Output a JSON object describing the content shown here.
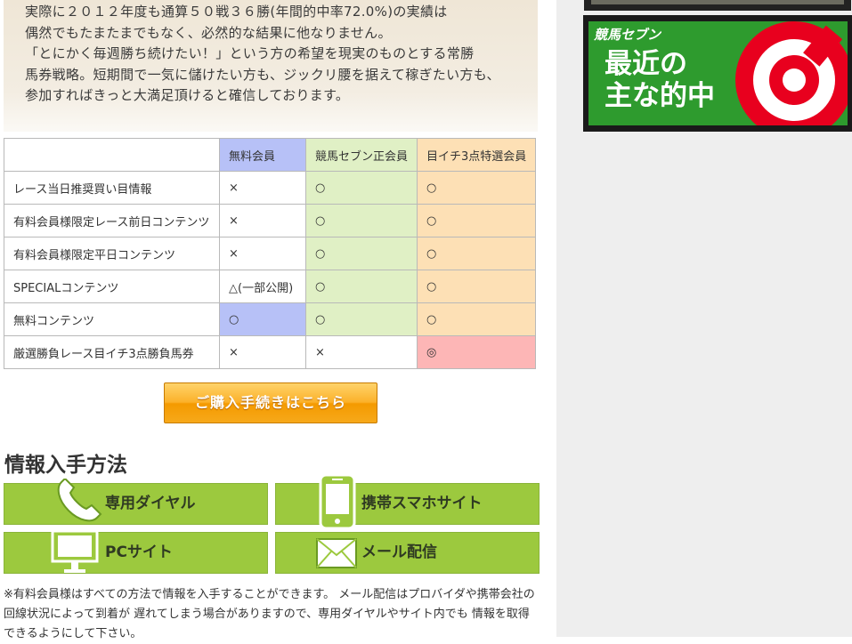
{
  "intro": {
    "lines": [
      "実際に２０１２年度も通算５０戦３６勝(年間的中率72.0%)の実績は",
      "偶然でもたまたまでもなく、必然的な結果に他なりません。",
      "「とにかく毎週勝ち続けたい！」という方の希望を現実のものとする常勝",
      "馬券戦略。短期間で一気に儲けたい方も、ジックリ腰を据えて稼ぎたい方も、",
      "参加すればきっと大満足頂けると確信しております。"
    ]
  },
  "table": {
    "headers": [
      "",
      "無料会員",
      "競馬セブン正会員",
      "目イチ3点特選会員"
    ],
    "rows": [
      [
        "レース当日推奨買い目情報",
        "×",
        "○",
        "○"
      ],
      [
        "有料会員様限定レース前日コンテンツ",
        "×",
        "○",
        "○"
      ],
      [
        "有料会員様限定平日コンテンツ",
        "×",
        "○",
        "○"
      ],
      [
        "SPECIALコンテンツ",
        "△(一部公開)",
        "○",
        "○"
      ],
      [
        "無料コンテンツ",
        "○",
        "○",
        "○"
      ],
      [
        "厳選勝負レース目イチ3点勝負馬券",
        "×",
        "×",
        "◎"
      ]
    ]
  },
  "buy_button": "ご購入手続きはこちら",
  "section_title": "情報入手方法",
  "methods": {
    "dial": "専用ダイヤル",
    "mobile": "携帯スマホサイト",
    "pc": "PCサイト",
    "mail": "メール配信"
  },
  "note": "※有料会員様はすべての方法で情報を入手することができます。 メール配信はプロバイダや携帯会社の回線状況によって到着が 遅れてしまう場合がありますので、専用ダイヤルやサイト内でも 情報を取得できるようにして下さい。",
  "sidebar": {
    "brand": "競馬セブン",
    "hit_line1": "最近の",
    "hit_line2": "主な的中"
  },
  "colors": {
    "free": "#b7c1f7",
    "regular": "#e0f0c5",
    "special": "#fde0b5",
    "highlight": "#fdb6b6",
    "method_green": "#9cc93e",
    "buy_orange": "#f7a91a"
  },
  "icons": [
    "phone-icon",
    "smartphone-icon",
    "monitor-icon",
    "envelope-icon",
    "target-icon"
  ]
}
